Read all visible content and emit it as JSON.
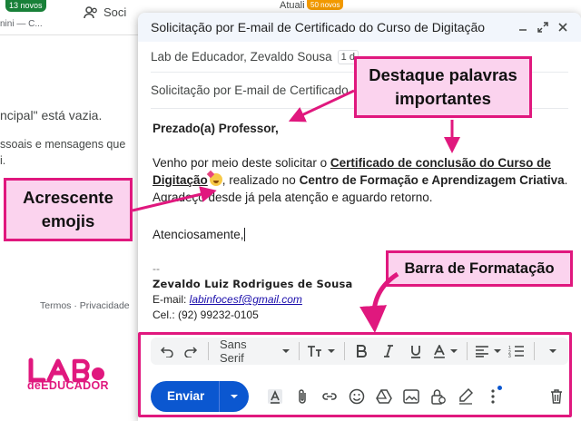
{
  "background": {
    "badge_new": "13 novos",
    "badge_new2": "50 novos",
    "social_tab": "Soci",
    "update_tab": "Atuali",
    "snippet_top": "nini — C...",
    "empty_msg": "ncipal\" está vazia.",
    "line1": "ssoais e mensagens que",
    "line2": "i.",
    "footer": "Termos · Privacidade"
  },
  "compose": {
    "title": "Solicitação por E-mail de Certificado do Curso de Digitação",
    "to_value": "Lab de Educador, Zevaldo Sousa",
    "to_chip": "1 d",
    "subject_value": "Solicitação por E-mail de Certificado",
    "greeting": "Prezado(a) Professor,",
    "para1_a": "Venho por meio deste solicitar o ",
    "para1_cert": "Certificado de conclusão do Curso de Digitação",
    "para1_b": ", realizado no ",
    "para1_center": "Centro de Formação e Aprendizagem Criativa",
    "para1_c": ".",
    "para2": "Agradeço desde já pela atenção e aguardo retorno.",
    "closing": "Atenciosamente,",
    "sig_dash": "--",
    "sig_name": "Zevaldo Luiz Rodrigues de Sousa",
    "sig_email_label": "E-mail: ",
    "sig_email": "labinfocesf@gmail.com",
    "sig_phone": "Cel.: (92) 99232-0105"
  },
  "toolbar": {
    "font": "Sans Serif"
  },
  "send": {
    "label": "Enviar"
  },
  "annotations": {
    "highlight": "Destaque palavras importantes",
    "emojis": "Acrescente emojis",
    "format_bar": "Barra de Formatação"
  },
  "logo": {
    "text": "LAB",
    "sub": "deEDUCADOR"
  },
  "colors": {
    "accent_pink": "#e0187e",
    "callout_fill": "#fbd3ee",
    "send_blue": "#0b57d0"
  }
}
